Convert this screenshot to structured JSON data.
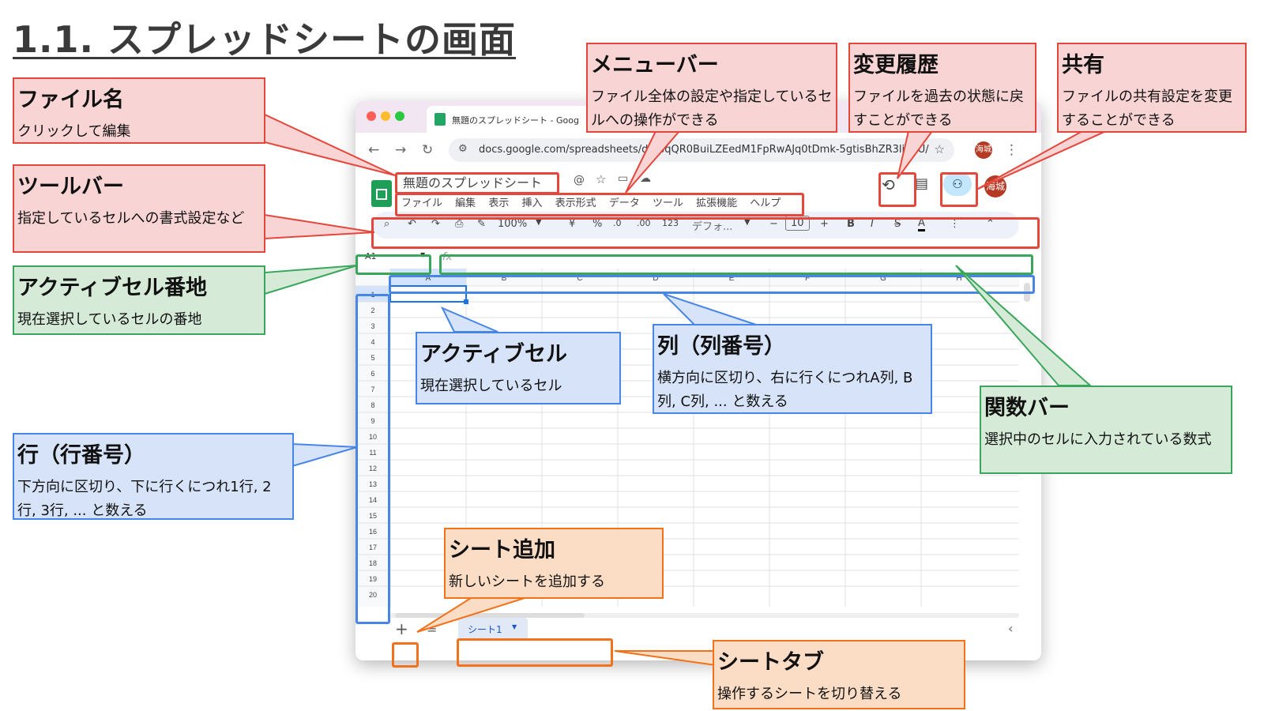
{
  "slide": {
    "title": "1.1. スプレッドシートの画面"
  },
  "browser": {
    "tab_title": "無題のスプレッドシート - Goog",
    "url": "docs.google.com/spreadsheets/d/1pqQR0BuiLZEedM1FpRwAJq0tDmk-5gtisBhZR3li70U/...",
    "profile_label": "海城"
  },
  "app": {
    "doc_title": "無題のスプレッドシート",
    "menu": [
      "ファイル",
      "編集",
      "表示",
      "挿入",
      "表示形式",
      "データ",
      "ツール",
      "拡張機能",
      "ヘルプ"
    ],
    "toolbar": {
      "zoom": "100%",
      "currency": "¥",
      "percent": "%",
      "dec_decrease": ".0",
      "dec_increase": ".00",
      "number_format": "123",
      "font": "デフォ...",
      "font_size": "10",
      "bold": "B",
      "italic": "I",
      "strike": "S",
      "text_color": "A"
    },
    "name_box": "A1",
    "fx_label": "fx",
    "columns": [
      "A",
      "B",
      "C",
      "D",
      "E",
      "F",
      "G",
      "H"
    ],
    "rows": [
      "1",
      "2",
      "3",
      "4",
      "5",
      "6",
      "7",
      "8",
      "9",
      "10",
      "11",
      "12",
      "13",
      "14",
      "15",
      "16",
      "17",
      "18",
      "19",
      "20"
    ],
    "sheet_tab": "シート1",
    "avatar_label": "海城"
  },
  "callouts": {
    "file_name": {
      "title": "ファイル名",
      "desc": "クリックして編集"
    },
    "toolbar": {
      "title": "ツールバー",
      "desc": "指定しているセルへの書式設定など"
    },
    "active_cell_address": {
      "title": "アクティブセル番地",
      "desc": "現在選択しているセルの番地"
    },
    "row": {
      "title": "行（行番号）",
      "desc": "下方向に区切り、下に行くにつれ1行, 2行, 3行, ... と数える"
    },
    "menu_bar": {
      "title": "メニューバー",
      "desc": "ファイル全体の設定や指定しているセルへの操作ができる"
    },
    "history": {
      "title": "変更履歴",
      "desc": "ファイルを過去の状態に戻すことができる"
    },
    "share": {
      "title": "共有",
      "desc": "ファイルの共有設定を変更することができる"
    },
    "active_cell": {
      "title": "アクティブセル",
      "desc": "現在選択しているセル"
    },
    "column": {
      "title": "列（列番号）",
      "desc": "横方向に区切り、右に行くにつれA列, B列, C列, ... と数える"
    },
    "function_bar": {
      "title": "関数バー",
      "desc": "選択中のセルに入力されている数式"
    },
    "add_sheet": {
      "title": "シート追加",
      "desc": "新しいシートを追加する"
    },
    "sheet_tab": {
      "title": "シートタブ",
      "desc": "操作するシートを切り替える"
    }
  },
  "colors": {
    "red": "#e4473c",
    "red_fill": "#f9d4d4",
    "green": "#3aa65b",
    "green_fill": "#d5ead7",
    "blue": "#4786e6",
    "blue_fill": "#d6e3f9",
    "orange": "#f1721a",
    "orange_fill": "#fbdcc4"
  }
}
